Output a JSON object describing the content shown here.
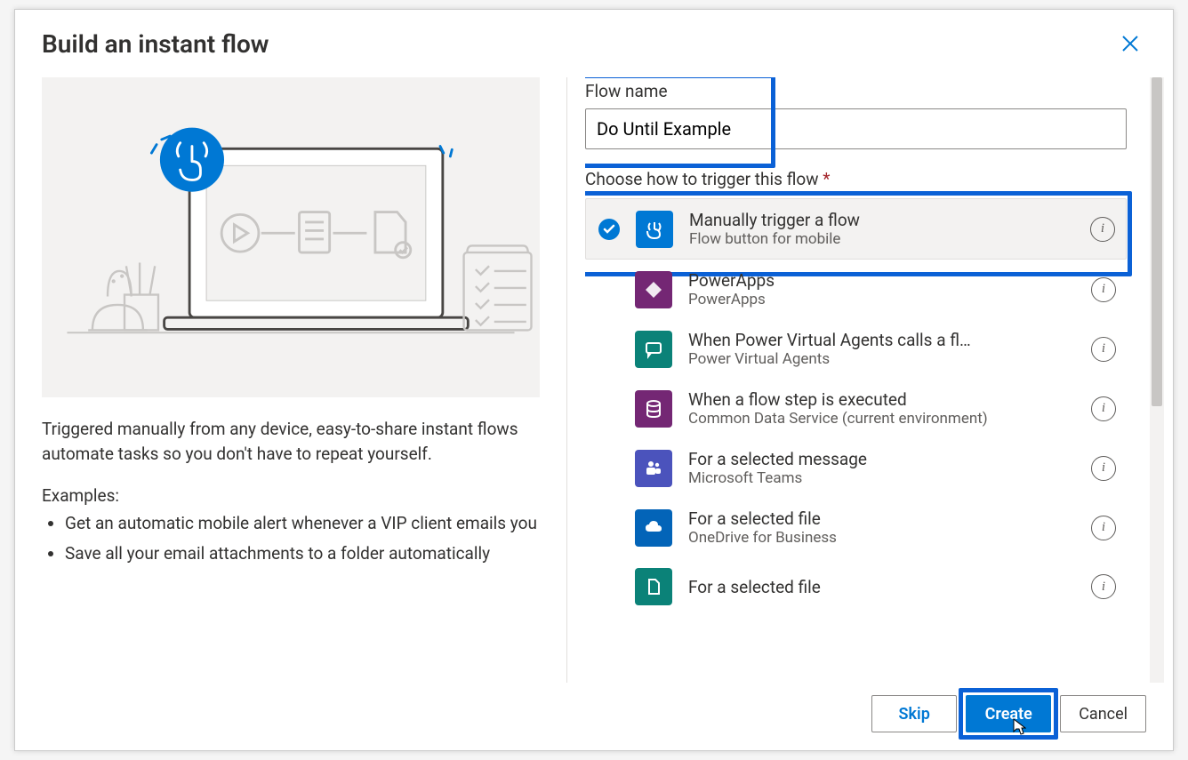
{
  "dialog": {
    "title": "Build an instant flow",
    "description": "Triggered manually from any device, easy-to-share instant flows automate tasks so you don't have to repeat yourself.",
    "examples_label": "Examples:",
    "examples": [
      "Get an automatic mobile alert whenever a VIP client emails you",
      "Save all your email attachments to a folder automatically"
    ]
  },
  "form": {
    "flow_name_label": "Flow name",
    "flow_name_value": "Do Until Example",
    "choose_label": "Choose how to trigger this flow",
    "info_glyph": "i"
  },
  "triggers": [
    {
      "title": "Manually trigger a flow",
      "subtitle": "Flow button for mobile",
      "icon_bg": "#0078d4",
      "icon_name": "touch-icon",
      "selected": true
    },
    {
      "title": "PowerApps",
      "subtitle": "PowerApps",
      "icon_bg": "#742774",
      "icon_name": "powerapps-icon",
      "selected": false
    },
    {
      "title": "When Power Virtual Agents calls a fl…",
      "subtitle": "Power Virtual Agents",
      "icon_bg": "#0b8278",
      "icon_name": "chat-icon",
      "selected": false
    },
    {
      "title": "When a flow step is executed",
      "subtitle": "Common Data Service (current environment)",
      "icon_bg": "#742774",
      "icon_name": "database-icon",
      "selected": false
    },
    {
      "title": "For a selected message",
      "subtitle": "Microsoft Teams",
      "icon_bg": "#4b53bc",
      "icon_name": "teams-icon",
      "selected": false
    },
    {
      "title": "For a selected file",
      "subtitle": "OneDrive for Business",
      "icon_bg": "#0364b8",
      "icon_name": "cloud-icon",
      "selected": false
    },
    {
      "title": "For a selected file",
      "subtitle": "",
      "icon_bg": "#0b8278",
      "icon_name": "file-icon",
      "selected": false
    }
  ],
  "footer": {
    "skip": "Skip",
    "create": "Create",
    "cancel": "Cancel"
  }
}
